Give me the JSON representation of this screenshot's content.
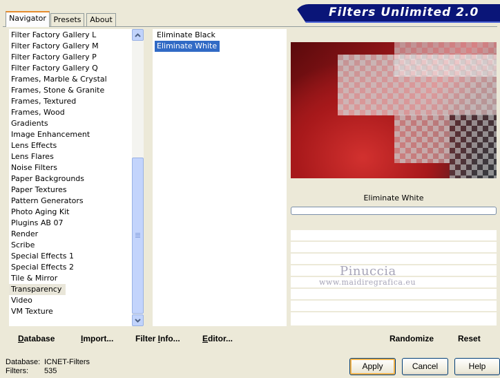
{
  "tabs": [
    {
      "label": "Navigator"
    },
    {
      "label": "Presets"
    },
    {
      "label": "About"
    }
  ],
  "banner": {
    "title": "Filters Unlimited 2.0"
  },
  "categories": [
    "Filter Factory Gallery L",
    "Filter Factory Gallery M",
    "Filter Factory Gallery P",
    "Filter Factory Gallery Q",
    "Frames, Marble & Crystal",
    "Frames, Stone & Granite",
    "Frames, Textured",
    "Frames, Wood",
    "Gradients",
    "Image Enhancement",
    "Lens Effects",
    "Lens Flares",
    "Noise Filters",
    "Paper Backgrounds",
    "Paper Textures",
    "Pattern Generators",
    "Photo Aging Kit",
    "Plugins AB 07",
    "Render",
    "Scribe",
    "Special Effects 1",
    "Special Effects 2",
    "Tile & Mirror",
    "Transparency",
    "Video",
    "VM Texture"
  ],
  "selected_category": "Transparency",
  "filters": [
    "Eliminate Black",
    "Eliminate White"
  ],
  "selected_filter": "Eliminate White",
  "preview": {
    "filter_label": "Eliminate White"
  },
  "watermark": {
    "line1": "Pinuccia",
    "line2": "www.maidiregrafica.eu"
  },
  "toolbar": {
    "database_prefix": "D",
    "database_rest": "atabase",
    "import_prefix": "I",
    "import_rest": "mport...",
    "filter_info_prefix": "Filter ",
    "filter_info_u": "I",
    "filter_info_rest": "nfo...",
    "editor_prefix": "E",
    "editor_rest": "ditor...",
    "randomize": "Randomize",
    "reset": "Reset"
  },
  "status": {
    "database_label": "Database:",
    "database_value": "ICNET-Filters",
    "filters_label": "Filters:",
    "filters_value": "535"
  },
  "buttons": {
    "apply": "Apply",
    "cancel": "Cancel",
    "help": "Help"
  },
  "colors": {
    "selection": "#316ac5",
    "banner": "#0a1578",
    "tab_accent": "#e68b2c"
  }
}
